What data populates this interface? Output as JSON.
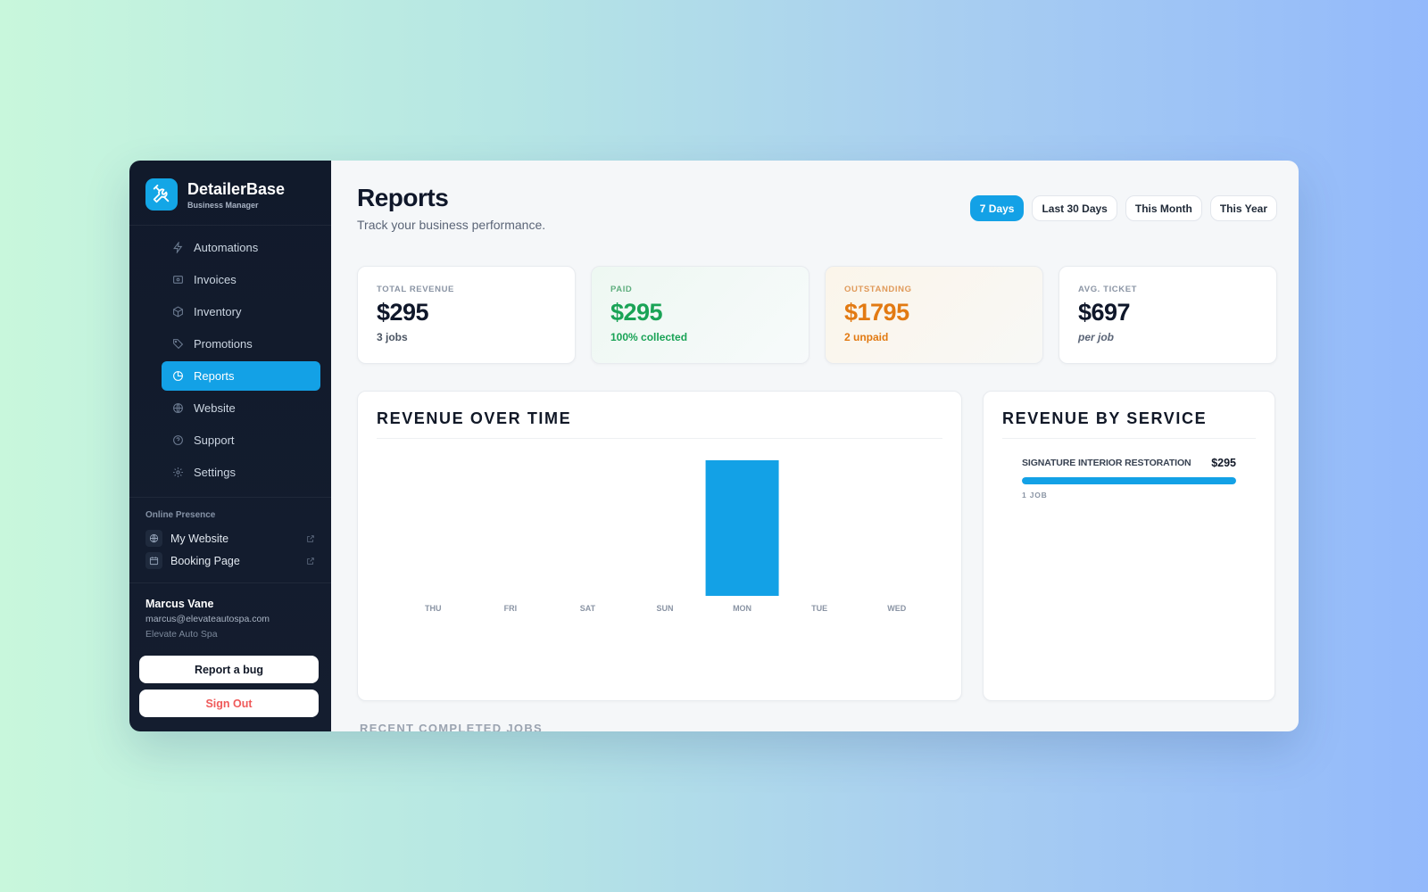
{
  "brand": {
    "name": "DetailerBase",
    "subtitle": "Business Manager"
  },
  "nav": [
    {
      "label": "Automations",
      "icon": "lightning-icon",
      "active": false
    },
    {
      "label": "Invoices",
      "icon": "invoice-icon",
      "active": false
    },
    {
      "label": "Inventory",
      "icon": "box-icon",
      "active": false
    },
    {
      "label": "Promotions",
      "icon": "tag-icon",
      "active": false
    },
    {
      "label": "Reports",
      "icon": "pie-chart-icon",
      "active": true
    },
    {
      "label": "Website",
      "icon": "globe-icon",
      "active": false
    },
    {
      "label": "Support",
      "icon": "help-circle-icon",
      "active": false
    },
    {
      "label": "Settings",
      "icon": "gear-icon",
      "active": false
    }
  ],
  "presence": {
    "title": "Online Presence",
    "items": [
      {
        "label": "My Website",
        "icon": "globe-icon"
      },
      {
        "label": "Booking Page",
        "icon": "calendar-icon"
      }
    ]
  },
  "user": {
    "name": "Marcus Vane",
    "email": "marcus@elevateautospa.com",
    "company": "Elevate Auto Spa"
  },
  "actions": {
    "report_bug": "Report a bug",
    "sign_out": "Sign Out"
  },
  "page": {
    "title": "Reports",
    "subtitle": "Track your business performance."
  },
  "ranges": [
    {
      "label": "7 Days",
      "active": true
    },
    {
      "label": "Last 30 Days",
      "active": false
    },
    {
      "label": "This Month",
      "active": false
    },
    {
      "label": "This Year",
      "active": false
    }
  ],
  "stats": {
    "total": {
      "label": "TOTAL REVENUE",
      "value": "$295",
      "note": "3 jobs"
    },
    "paid": {
      "label": "PAID",
      "value": "$295",
      "note": "100% collected"
    },
    "outstanding": {
      "label": "OUTSTANDING",
      "value": "$1795",
      "note": "2 unpaid"
    },
    "avg": {
      "label": "AVG. TICKET",
      "value": "$697",
      "note": "per job"
    }
  },
  "revenue_panel": {
    "title": "REVENUE OVER TIME"
  },
  "service_panel": {
    "title": "REVENUE BY SERVICE",
    "services": [
      {
        "name": "SIGNATURE INTERIOR RESTORATION",
        "amount": "$295",
        "jobs": "1 JOB",
        "share": 1.0
      }
    ]
  },
  "recent_title": "RECENT COMPLETED JOBS",
  "colors": {
    "accent": "#13a1e6",
    "paid": "#1aa356",
    "outstanding": "#e27a12"
  },
  "chart_data": {
    "type": "bar",
    "categories": [
      "THU",
      "FRI",
      "SAT",
      "SUN",
      "MON",
      "TUE",
      "WED"
    ],
    "values": [
      0,
      0,
      0,
      0,
      295,
      0,
      0
    ],
    "title": "REVENUE OVER TIME",
    "xlabel": "",
    "ylabel": "",
    "ylim": [
      0,
      295
    ],
    "grid": false,
    "color": "#13a1e6"
  }
}
